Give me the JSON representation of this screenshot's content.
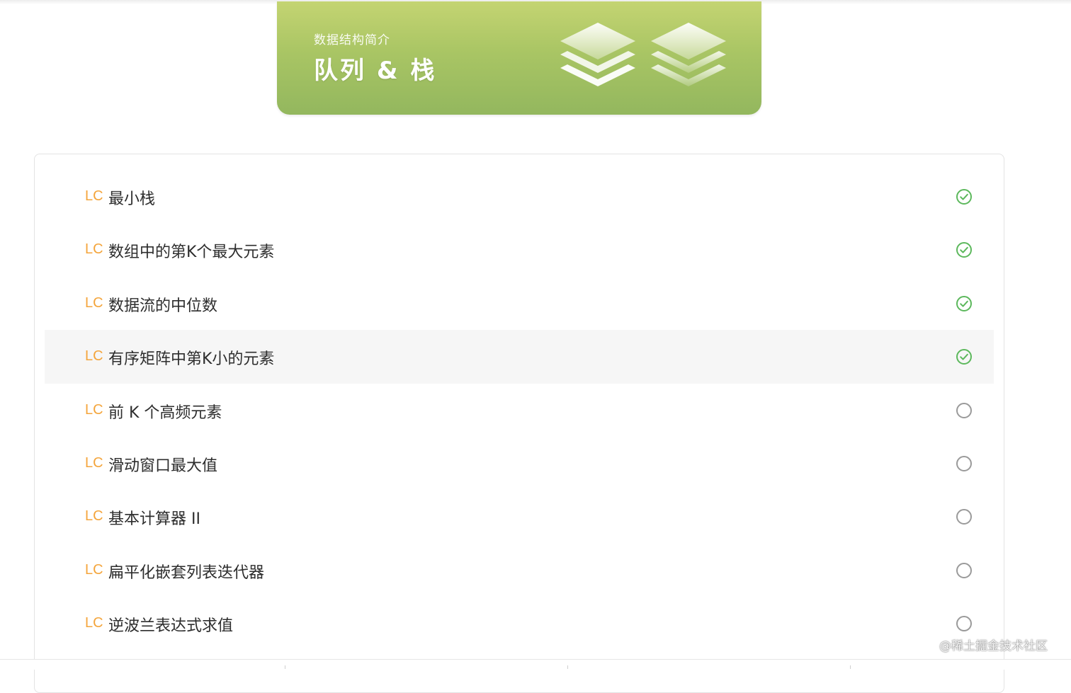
{
  "banner": {
    "subtitle": "数据结构简介",
    "title": "队列 & 栈",
    "gradient_top": "#c4d472",
    "gradient_bottom": "#93b75e",
    "art_icon": "stacked-layers-icon"
  },
  "problems": [
    {
      "prefix": "LC",
      "title": "最小栈",
      "status": "completed"
    },
    {
      "prefix": "LC",
      "title": "数组中的第K个最大元素",
      "status": "completed"
    },
    {
      "prefix": "LC",
      "title": "数据流的中位数",
      "status": "completed"
    },
    {
      "prefix": "LC",
      "title": "有序矩阵中第K小的元素",
      "status": "completed"
    },
    {
      "prefix": "LC",
      "title": "前 K 个高频元素",
      "status": "todo"
    },
    {
      "prefix": "LC",
      "title": "滑动窗口最大值",
      "status": "todo"
    },
    {
      "prefix": "LC",
      "title": "基本计算器 II",
      "status": "todo"
    },
    {
      "prefix": "LC",
      "title": "扁平化嵌套列表迭代器",
      "status": "todo"
    },
    {
      "prefix": "LC",
      "title": "逆波兰表达式求值",
      "status": "todo"
    }
  ],
  "colors": {
    "prefix": "#f4a53c",
    "completed": "#5cb85c",
    "todo": "#9a9a9a",
    "hover_row": "#f6f6f6"
  },
  "watermark": "@稀土掘金技术社区"
}
